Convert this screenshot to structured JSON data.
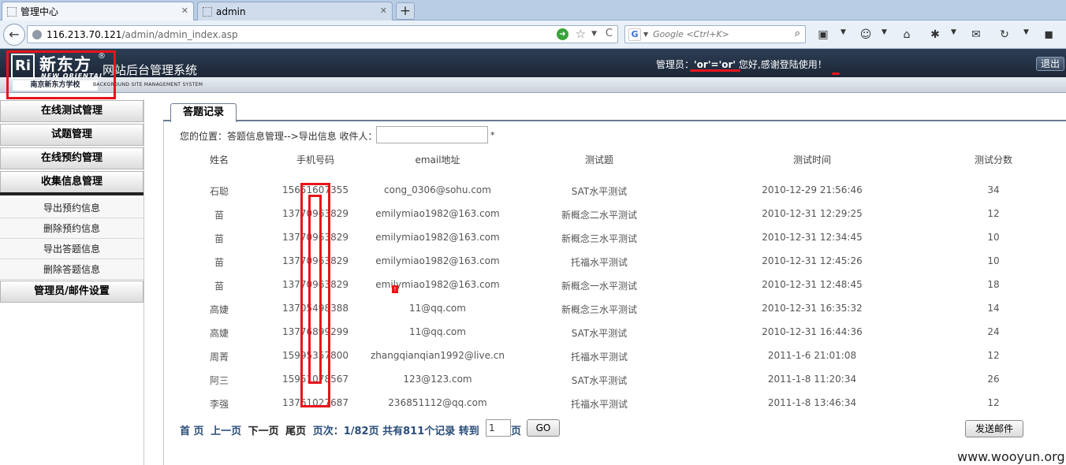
{
  "browser": {
    "tabs": [
      {
        "label": "管理中心",
        "active": true
      },
      {
        "label": "admin",
        "active": false
      }
    ],
    "new_tab": "+",
    "url_host": "116.213.70.121",
    "url_path": "/admin/admin_index.asp",
    "search_engine": "G",
    "search_placeholder": "Google <Ctrl+K>"
  },
  "header": {
    "logo_mark": "Ri",
    "logo_brand": "新东方",
    "logo_reg": "®",
    "logo_en": "NEW ORIENTAL",
    "logo_school": "南京新东方学校",
    "system_title": "网站后台管理系统",
    "system_subtitle": "BACKGROUND SITE MANAGEMENT SYSTEM",
    "greeting_prefix": "管理员：",
    "admin_name": "'or'='or'",
    "greeting_suffix": " 您好,感谢登陆使用！",
    "logout_label": "退出"
  },
  "sidebar": {
    "sections": [
      {
        "label": "在线测试管理"
      },
      {
        "label": "试题管理"
      },
      {
        "label": "在线预约管理"
      },
      {
        "label": "收集信息管理"
      }
    ],
    "sub_items": [
      {
        "label": "导出预约信息"
      },
      {
        "label": "删除预约信息"
      },
      {
        "label": "导出答题信息"
      },
      {
        "label": "删除答题信息"
      }
    ],
    "footer_section": "管理员/邮件设置"
  },
  "main": {
    "tab_label": "答题记录",
    "position_text": "您的位置：答题信息管理-->导出信息 收件人：",
    "recipient_value": "",
    "required_mark": "*",
    "columns": [
      "姓名",
      "手机号码",
      "email地址",
      "测试题",
      "测试时间",
      "测试分数"
    ],
    "rows": [
      [
        "石聪",
        "15651607355",
        "cong_0306@sohu.com",
        "SAT水平测试",
        "2010-12-29 21:56:46",
        "34"
      ],
      [
        "苗",
        "13770963829",
        "emilymiao1982@163.com",
        "新概念二水平测试",
        "2010-12-31 12:29:25",
        "12"
      ],
      [
        "苗",
        "13770963829",
        "emilymiao1982@163.com",
        "新概念三水平测试",
        "2010-12-31 12:34:45",
        "10"
      ],
      [
        "苗",
        "13770963829",
        "emilymiao1982@163.com",
        "托福水平测试",
        "2010-12-31 12:45:26",
        "10"
      ],
      [
        "苗",
        "13770963829",
        "emilymiao1982@163.com",
        "新概念一水平测试",
        "2010-12-31 12:48:45",
        "18"
      ],
      [
        "高婕",
        "13705498388",
        "11@qq.com",
        "新概念三水平测试",
        "2010-12-31 16:35:32",
        "14"
      ],
      [
        "高婕",
        "13776899299",
        "11@qq.com",
        "SAT水平测试",
        "2010-12-31 16:44:36",
        "24"
      ],
      [
        "周菁",
        "15995357800",
        "zhangqianqian1992@live.cn",
        "托福水平测试",
        "2011-1-6 21:01:08",
        "12"
      ],
      [
        "阿三",
        "15951078567",
        "123@123.com",
        "SAT水平测试",
        "2011-1-8 11:20:34",
        "26"
      ],
      [
        "李强",
        "13761027687",
        "236851112@qq.com",
        "托福水平测试",
        "2011-1-8 13:46:34",
        "12"
      ]
    ],
    "pager": {
      "first": "首 页",
      "prev": "上一页",
      "next": "下一页",
      "last": "尾页",
      "status": "页次：1/82页 共有811个记录 转到",
      "page_value": "1",
      "page_unit": "页",
      "go_label": "GO"
    },
    "send_mail_label": "发送邮件"
  },
  "watermark": "www.wooyun.org",
  "colors": {
    "header_bg": "#1c2636",
    "annotation_red": "#e8141b",
    "link_blue": "#2a4d79"
  }
}
